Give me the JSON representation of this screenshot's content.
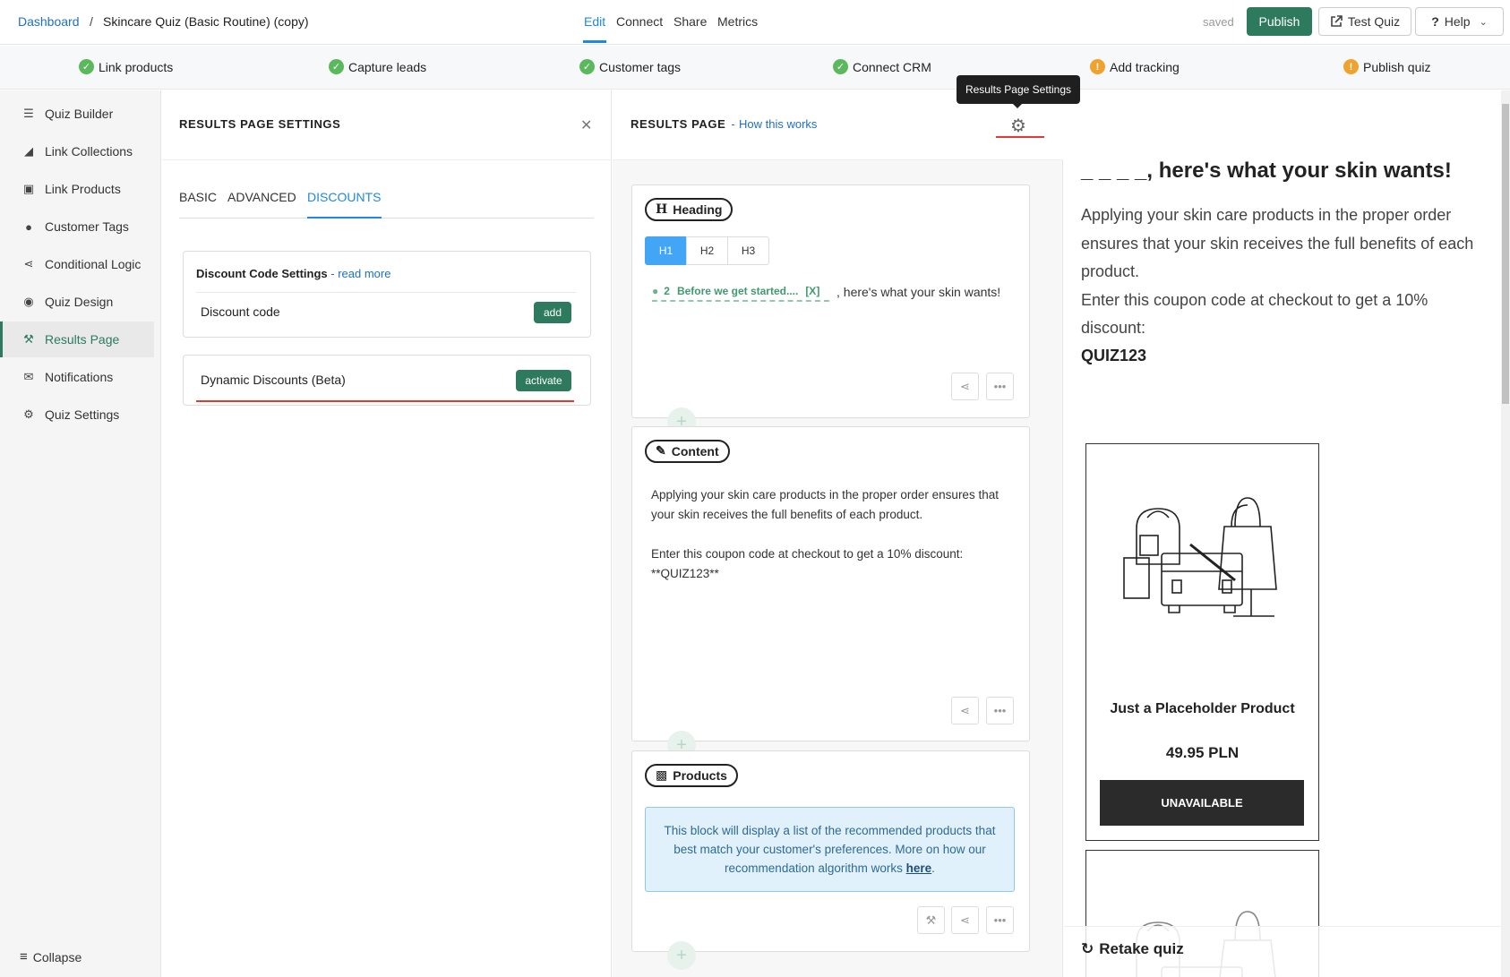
{
  "topbar": {
    "breadcrumb_root": "Dashboard",
    "breadcrumb_sep": "/",
    "quiz_title": "Skincare Quiz (Basic Routine) (copy)",
    "tabs": [
      "Edit",
      "Connect",
      "Share",
      "Metrics"
    ],
    "active_tab": "Edit",
    "status": "saved",
    "publish_label": "Publish",
    "test_quiz_label": "Test Quiz",
    "help_label": "Help"
  },
  "checklist": [
    {
      "label": "Link products",
      "state": "done"
    },
    {
      "label": "Capture leads",
      "state": "done"
    },
    {
      "label": "Customer tags",
      "state": "done"
    },
    {
      "label": "Connect CRM",
      "state": "done"
    },
    {
      "label": "Add tracking",
      "state": "warning"
    },
    {
      "label": "Publish quiz",
      "state": "warning"
    }
  ],
  "tooltip": "Results Page Settings",
  "sidebar": {
    "items": [
      {
        "label": "Quiz Builder",
        "icon": "list-icon"
      },
      {
        "label": "Link Collections",
        "icon": "tag-icon"
      },
      {
        "label": "Link Products",
        "icon": "box-icon"
      },
      {
        "label": "Customer Tags",
        "icon": "user-icon"
      },
      {
        "label": "Conditional Logic",
        "icon": "branch-icon"
      },
      {
        "label": "Quiz Design",
        "icon": "droplet-icon"
      },
      {
        "label": "Results Page",
        "icon": "cart-icon"
      },
      {
        "label": "Notifications",
        "icon": "envelope-icon"
      },
      {
        "label": "Quiz Settings",
        "icon": "gear-icon"
      }
    ],
    "active": "Results Page",
    "collapse_label": "Collapse"
  },
  "settings_panel": {
    "title": "RESULTS PAGE SETTINGS",
    "tabs": [
      "BASIC",
      "ADVANCED",
      "DISCOUNTS"
    ],
    "active_tab": "DISCOUNTS",
    "discount_card": {
      "title": "Discount Code Settings",
      "title_sep": " - ",
      "read_more": "read more",
      "row_label": "Discount code",
      "button": "add"
    },
    "dynamic_card": {
      "label": "Dynamic Discounts (Beta)",
      "button": "activate"
    }
  },
  "editor": {
    "title": "RESULTS PAGE",
    "title_sep": "-",
    "how_link": "How this works",
    "heading_block": {
      "pill": "Heading",
      "levels": [
        "H1",
        "H2",
        "H3"
      ],
      "selected_level": "H1",
      "variable_chip": {
        "question_number": "2",
        "text": "Before we get started....",
        "remove": "[X]"
      },
      "text": ", here's what your skin wants!"
    },
    "content_block": {
      "pill": "Content",
      "text": "Applying your skin care products in the proper order ensures that your skin receives the full benefits of each product.\n\nEnter this coupon code at checkout to get a 10% discount:\n**QUIZ123**"
    },
    "products_block": {
      "pill": "Products",
      "info": "This block will display a list of the recommended products that best match your customer's preferences. More on how our recommendation algorithm works ",
      "info_link": "here",
      "info_end": "."
    }
  },
  "preview": {
    "heading_blank": "_ _ _ _",
    "heading_text": ", here's what your skin wants!",
    "body_line1": "Applying your skin care products in the proper order ensures that your skin receives the full benefits of each product.",
    "body_line2": "Enter this coupon code at checkout to get a 10% discount:",
    "code": "QUIZ123",
    "product": {
      "name": "Just a Placeholder Product",
      "price": "49.95 PLN",
      "button": "UNAVAILABLE"
    },
    "retake_label": "Retake quiz"
  },
  "colors": {
    "brand_green": "#2d7a5e",
    "accent_blue": "#1e88e5",
    "check_green": "#5cb85c",
    "warn_orange": "#f0a22e",
    "highlight_red": "#e53935"
  }
}
